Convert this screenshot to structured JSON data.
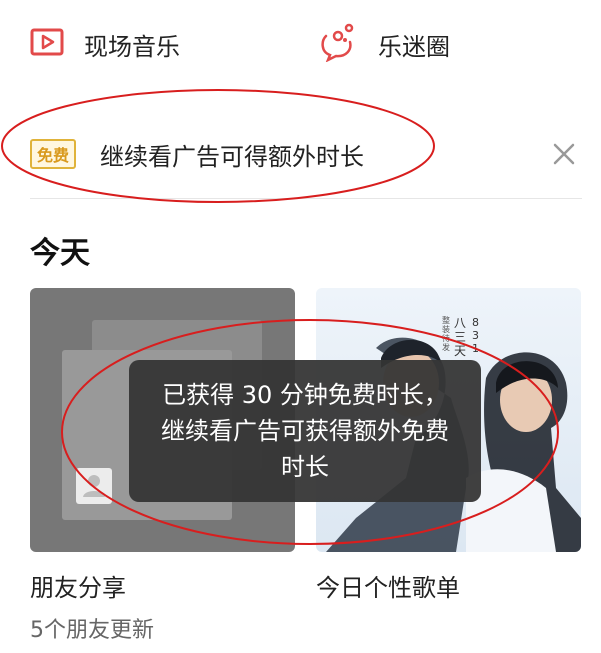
{
  "nav": {
    "live_music": {
      "label": "现场音乐",
      "icon": "play-video-icon"
    },
    "fan_circle": {
      "label": "乐迷圈",
      "icon": "chat-bubble-icon"
    }
  },
  "promo": {
    "badge": "免费",
    "text": "继续看广告可得额外时长",
    "close_icon": "close-icon"
  },
  "section": {
    "title": "今天"
  },
  "cards": [
    {
      "title": "朋友分享",
      "subtitle": "5个朋友更新",
      "icon": "avatar-placeholder-icon"
    },
    {
      "title": "今日个性歌单",
      "cover_text": [
        "八",
        "三",
        "天",
        "8",
        "3",
        "1",
        "整装待发"
      ]
    }
  ],
  "toast": {
    "text": "已获得 30 分钟免费时长，继续看广告可获得额外免费时长"
  },
  "colors": {
    "accent": "#e24a4a",
    "badge": "#e0b33a",
    "annotation": "#d81e1e"
  }
}
